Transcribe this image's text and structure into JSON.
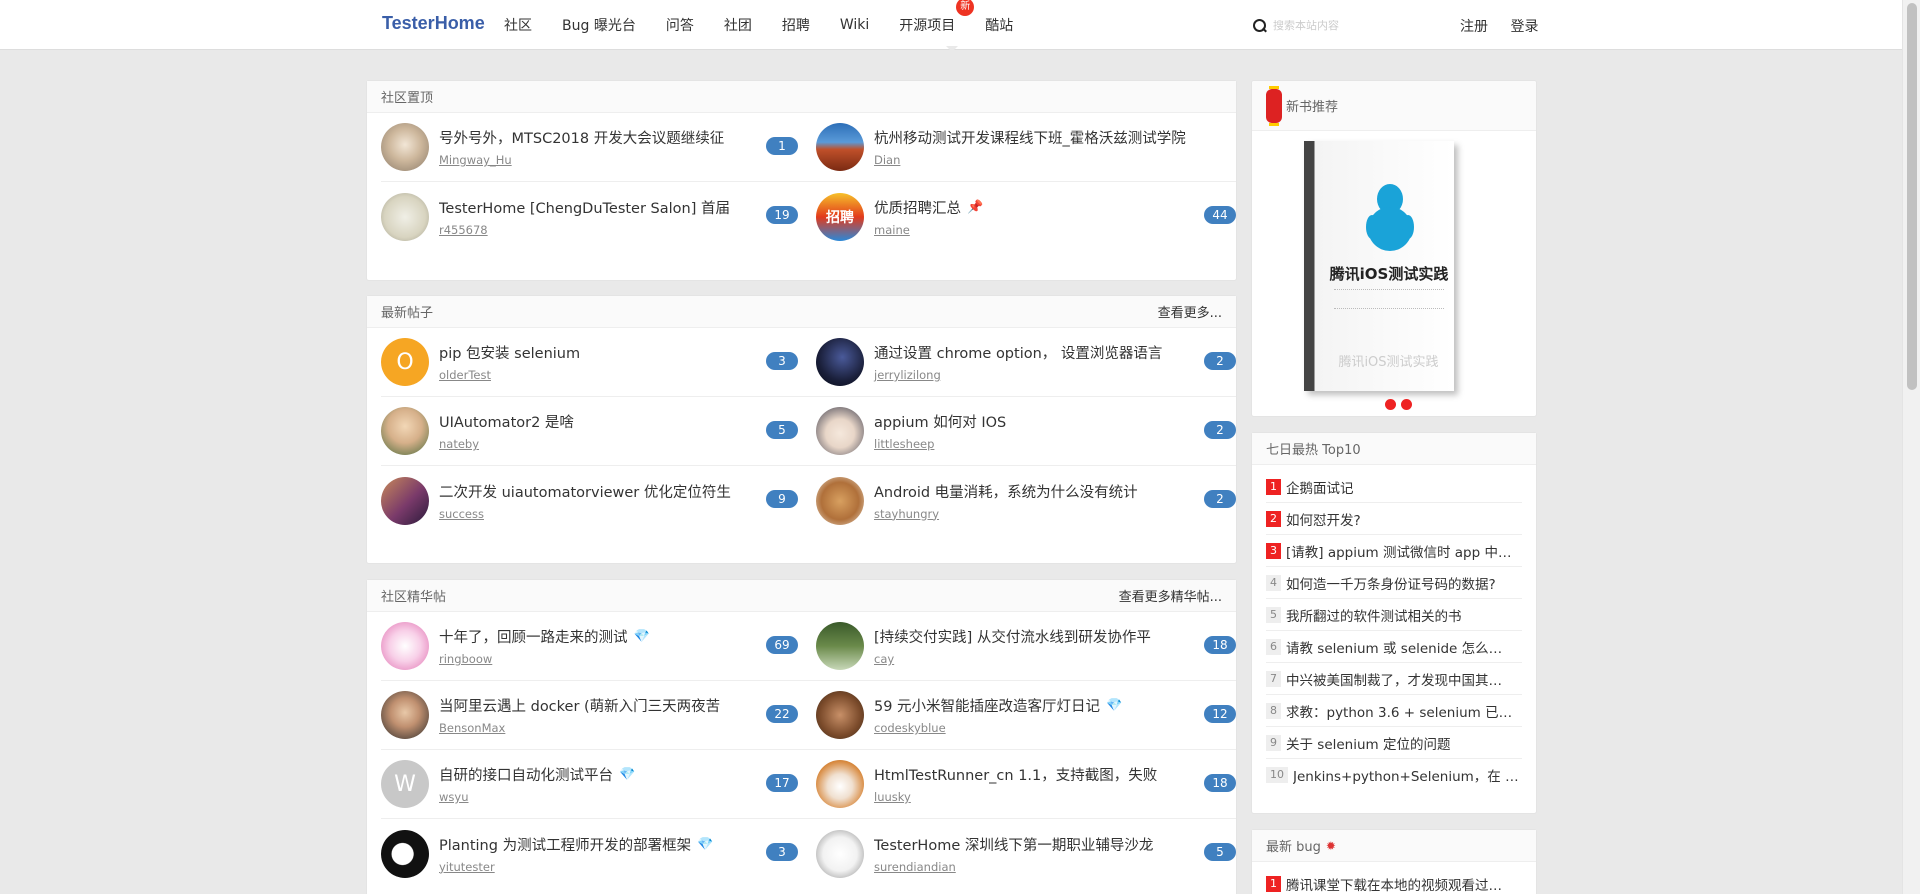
{
  "nav": {
    "brand": "TesterHome",
    "links": [
      "社区",
      "Bug 曝光台",
      "问答",
      "社团",
      "招聘",
      "Wiki",
      "开源项目",
      "酷站"
    ],
    "new_badge": "新",
    "search_placeholder": "搜索本站内容",
    "register": "注册",
    "login": "登录"
  },
  "pinned": {
    "title": "社区置顶",
    "topics": [
      {
        "title": "号外号外，MTSC2018 开发大会议题继续征",
        "user": "Mingway_Hu",
        "count": "1",
        "avatar": "cat"
      },
      {
        "title": "杭州移动测试开发课程线下班_霍格沃兹测试学院",
        "user": "Dian",
        "count": "",
        "avatar": "rock"
      },
      {
        "title": "TesterHome [ChengDuTester Salon] 首届",
        "user": "r455678",
        "count": "19",
        "avatar": "sketch"
      },
      {
        "title": "优质招聘汇总",
        "user": "maine",
        "count": "44",
        "avatar": "zhaopin",
        "pin": "📌"
      }
    ]
  },
  "latest": {
    "title": "最新帖子",
    "more": "查看更多...",
    "topics": [
      {
        "title": "pip 包安装 selenium",
        "user": "olderTest",
        "count": "3",
        "avatar": "O"
      },
      {
        "title": "通过设置 chrome option， 设置浏览器语言",
        "user": "jerrylizilong",
        "count": "2",
        "avatar": "night"
      },
      {
        "title": "UIAutomator2 是啥",
        "user": "nateby",
        "count": "5",
        "avatar": "bald"
      },
      {
        "title": "appium 如何对 IOS",
        "user": "littlesheep",
        "count": "2",
        "avatar": "girl"
      },
      {
        "title": "二次开发 uiautomatorviewer 优化定位符生",
        "user": "success",
        "count": "9",
        "avatar": "guitar"
      },
      {
        "title": "Android 电量消耗，系统为什么没有统计",
        "user": "stayhungry",
        "count": "2",
        "avatar": "dog"
      }
    ]
  },
  "excellent": {
    "title": "社区精华帖",
    "more": "查看更多精华帖...",
    "topics": [
      {
        "title": "十年了，回顾一路走来的测试",
        "user": "ringboow",
        "count": "69",
        "avatar": "pink",
        "diamond": "💎"
      },
      {
        "title": "[持续交付实践] 从交付流水线到研发协作平",
        "user": "cay",
        "count": "18",
        "avatar": "grass"
      },
      {
        "title": "当阿里云遇上 docker (萌新入门三天两夜苦",
        "user": "BensonMax",
        "count": "22",
        "avatar": "man"
      },
      {
        "title": "59 元小米智能插座改造客厅灯日记",
        "user": "codeskyblue",
        "count": "12",
        "avatar": "room",
        "diamond": "💎"
      },
      {
        "title": "自研的接口自动化测试平台",
        "user": "wsyu",
        "count": "17",
        "avatar": "W",
        "diamond": "💎"
      },
      {
        "title": "HtmlTestRunner_cn 1.1，支持截图，失败",
        "user": "luusky",
        "count": "18",
        "avatar": "corgi"
      },
      {
        "title": "Planting 为测试工程师开发的部署框架",
        "user": "yitutester",
        "count": "3",
        "avatar": "head",
        "diamond": "💎"
      },
      {
        "title": "TesterHome 深圳线下第一期职业辅导沙龙",
        "user": "surendiandian",
        "count": "5",
        "avatar": "comic"
      }
    ]
  },
  "book": {
    "header": "新书推荐",
    "title": "腾讯iOS测试实践",
    "reflection": "腾讯iOS测试实践"
  },
  "hot": {
    "title": "七日最热 Top10",
    "items": [
      {
        "rank": "1",
        "text": "企鹅面试记"
      },
      {
        "rank": "2",
        "text": "如何怼开发?"
      },
      {
        "rank": "3",
        "text": "[请教] appium 测试微信时 app 中…"
      },
      {
        "rank": "4",
        "text": "如何造一千万条身份证号码的数据?"
      },
      {
        "rank": "5",
        "text": "我所翻过的软件测试相关的书"
      },
      {
        "rank": "6",
        "text": "请教 selenium 或 selenide 怎么…"
      },
      {
        "rank": "7",
        "text": "中兴被美国制裁了，才发现中国其…"
      },
      {
        "rank": "8",
        "text": "求教：python 3.6 + selenium 已…"
      },
      {
        "rank": "9",
        "text": "关于 selenium 定位的问题"
      },
      {
        "rank": "10",
        "text": "Jenkins+python+Selenium，在 …"
      }
    ]
  },
  "bugs": {
    "title": "最新 bug",
    "items": [
      {
        "rank": "1",
        "text": "腾讯课堂下载在本地的视频观看过…"
      }
    ]
  },
  "colors": {
    "accent": "#3a5ea8",
    "count_badge": "#4080c0",
    "rank_red": "#e22222",
    "background": "#e9e9e9"
  }
}
